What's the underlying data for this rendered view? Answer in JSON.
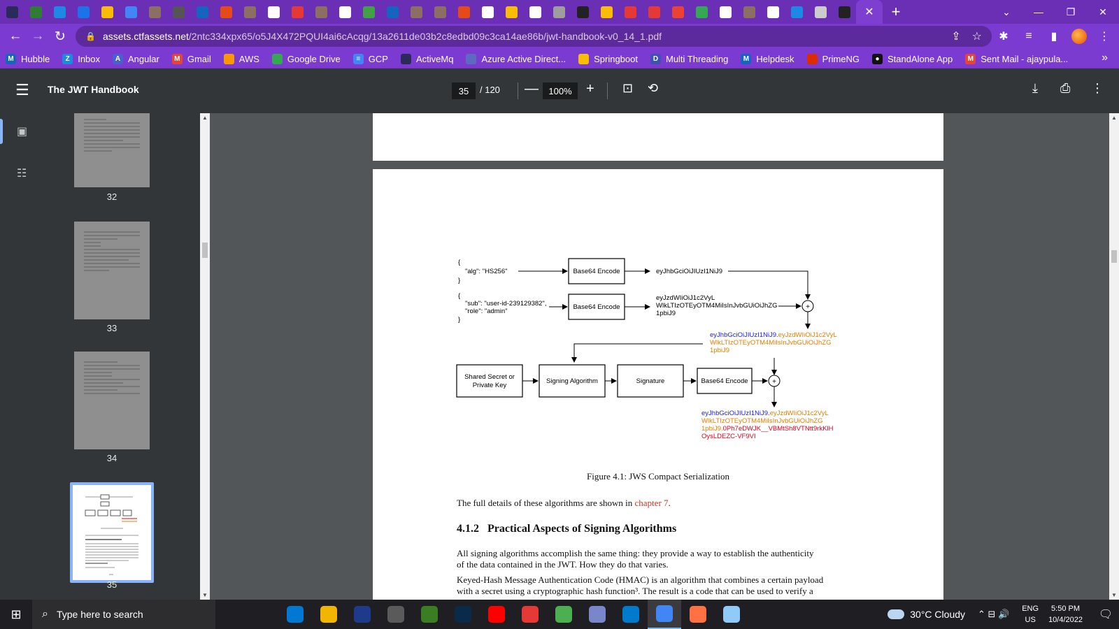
{
  "browser": {
    "tab_colors": [
      "#2b2b5a",
      "#2e7d32",
      "#1e88e5",
      "#1a73e8",
      "#fbbc04",
      "#4285f4",
      "#8d6e63",
      "#555",
      "#1565c0",
      "#e64a19",
      "#8d6e63",
      "#ffffff",
      "#e53935",
      "#8d6e63",
      "#ffffff",
      "#43a047",
      "#1565c0",
      "#8d6e63",
      "#8d6e63",
      "#e64a19",
      "#ffffff",
      "#fbbc04",
      "#ffffff",
      "#9e9e9e",
      "#222222",
      "#fbbc04",
      "#e53935",
      "#e53935",
      "#ea4335",
      "#34a853",
      "#ffffff",
      "#8d6e63",
      "#ffffff",
      "#1e88e5",
      "#cccccc",
      "#222222"
    ],
    "url_host": "assets.ctfassets.net",
    "url_path": "/2ntc334xpx65/o5J4X472PQUI4ai6cAcqg/13a2611de03b2c8edbd09c3ca14ae86b/jwt-handbook-v0_14_1.pdf",
    "bookmarks": [
      {
        "label": "Hubble",
        "icon": "M",
        "color": "#1565c0"
      },
      {
        "label": "Inbox",
        "icon": "Z",
        "color": "#1e88e5"
      },
      {
        "label": "Angular",
        "icon": "A",
        "color": "#4a5fd0"
      },
      {
        "label": "Gmail",
        "icon": "M",
        "color": "#ea4335"
      },
      {
        "label": "AWS",
        "icon": "",
        "color": "#ff9800"
      },
      {
        "label": "Google Drive",
        "icon": "",
        "color": "#34a853"
      },
      {
        "label": "GCP",
        "icon": "≡",
        "color": "#4285f4"
      },
      {
        "label": "ActiveMq",
        "icon": "",
        "color": "#2b2b5a"
      },
      {
        "label": "Azure Active Direct...",
        "icon": "",
        "color": "#5c6bc0"
      },
      {
        "label": "Springboot",
        "icon": "",
        "color": "#fbbc04"
      },
      {
        "label": "Multi Threading",
        "icon": "D",
        "color": "#3f51b5"
      },
      {
        "label": "Helpdesk",
        "icon": "M",
        "color": "#1565c0"
      },
      {
        "label": "PrimeNG",
        "icon": "",
        "color": "#dd2c00"
      },
      {
        "label": "StandAlone App",
        "icon": "●",
        "color": "#111111"
      },
      {
        "label": "Sent Mail - ajaypula...",
        "icon": "M",
        "color": "#ea4335"
      }
    ],
    "bookmarks_more": "»"
  },
  "pdf_toolbar": {
    "title": "The JWT Handbook",
    "current_page": "35",
    "total_pages": "/ 120",
    "zoom": "100%"
  },
  "thumbnails": [
    {
      "label": "32"
    },
    {
      "label": "33"
    },
    {
      "label": "34"
    },
    {
      "label": "35"
    }
  ],
  "figure": {
    "header_lines": [
      "{",
      "\"alg\": \"HS256\"",
      "}"
    ],
    "payload_lines": [
      "{",
      "\"sub\": \"user-id-239129382\",",
      "\"role\": \"admin\"",
      "}"
    ],
    "base64_encode": "Base64 Encode",
    "header_encoded": "eyJhbGciOiJIUzI1NiJ9",
    "payload_encoded": [
      "eyJzdWIiOiJ1c2VyL",
      "WlkLTIzOTEyOTM4MiIsInJvbGUiOiJhZG",
      "1pbiJ9"
    ],
    "joined_part1": "eyJhbGciOiJIUzI1NiJ9.",
    "joined_part2": "eyJzdWIiOiJ1c2VyL",
    "joined_line2": "WlkLTIzOTEyOTM4MiIsInJvbGUiOiJhZG",
    "joined_line3": "1pbiJ9",
    "shared_secret": [
      "Shared Secret or",
      "Private Key"
    ],
    "signing_algorithm": "Signing Algorithm",
    "signature": "Signature",
    "final_part1": "eyJhbGciOiJIUzI1NiJ9.",
    "final_part2": "eyJzdWIiOiJ1c2VyL",
    "final_line2": "WlkLTIzOTEyOTM4MiIsInJvbGUiOiJhZG",
    "final_line3a": "1pbiJ9.",
    "final_line3b": "0Ph7eDWJK__VBMtSh8VTNtt9rkKlH",
    "final_line4": "OysLDEZC-VF9VI",
    "colors": {
      "blue": "#1a1aff",
      "orange": "#e08000",
      "red": "#e0001a"
    }
  },
  "page_text": {
    "caption": "Figure 4.1: JWS Compact Serialization",
    "para1_a": "The full details of these algorithms are shown in ",
    "para1_link": "chapter 7",
    "para1_b": ".",
    "section_number": "4.1.2",
    "section_title": "Practical Aspects of Signing Algorithms",
    "para2_line1": "All signing algorithms accomplish the same thing: they provide a way to establish the authenticity",
    "para2_line2": "of the data contained in the JWT. How they do that varies.",
    "para3_line1": "Keyed-Hash Message Authentication Code (HMAC) is an algorithm that combines a certain payload",
    "para3_line2": "with a secret using a cryptographic hash function³. The result is a code that can be used to verify a"
  },
  "taskbar": {
    "search_placeholder": "Type here to search",
    "app_colors": [
      "#0078d4",
      "#f2b500",
      "#1e3a8a",
      "#5a5a5a",
      "#3b7d23",
      "#0a2a4a",
      "#ff0000",
      "#e53935",
      "#4caf50",
      "#7986cb",
      "#007acc",
      "#4285f4",
      "#ff7043",
      "#90caf9"
    ],
    "weather": "30°C  Cloudy",
    "lang_top": "ENG",
    "lang_bottom": "US",
    "time": "5:50 PM",
    "date": "10/4/2022"
  }
}
